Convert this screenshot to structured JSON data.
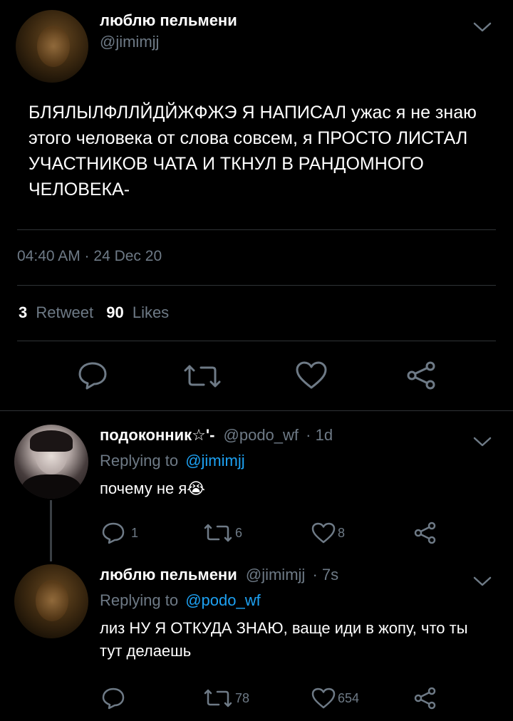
{
  "tweet": {
    "author_name": "люблю пельмени",
    "author_handle": "@jimimjj",
    "text": "БЛЯЛЫЛФЛЛЙДЙЖФЖЭ Я НАПИСАЛ ужас я не знаю этого человека от слова совсем, я ПРОСТО ЛИСТАЛ УЧАСТНИКОВ ЧАТА И ТКНУЛ В РАНДОМНОГО ЧЕЛОВЕКА-",
    "timestamp": "04:40 AM · 24 Dec 20",
    "retweets": "3",
    "retweets_label": "Retweet",
    "likes": "90",
    "likes_label": "Likes"
  },
  "replies": [
    {
      "author_name": "подоконник☆'-",
      "author_handle": "@podo_wf",
      "time": "· 1d",
      "replying_prefix": "Replying to",
      "replying_to": "@jimimjj",
      "text": "почему не я😭",
      "reply_count": "1",
      "retweet_count": "6",
      "like_count": "8"
    },
    {
      "author_name": "люблю пельмени",
      "author_handle": "@jimimjj",
      "time": "· 7s",
      "replying_prefix": "Replying to",
      "replying_to": "@podo_wf",
      "text": "лиз НУ Я ОТКУДА ЗНАЮ, ваще иди в жопу, что ты тут делаешь",
      "reply_count": "",
      "retweet_count": "78",
      "like_count": "654"
    }
  ],
  "icons": [
    "chevron-down-icon",
    "reply-icon",
    "retweet-icon",
    "like-icon",
    "share-icon"
  ],
  "colors": {
    "background": "#000000",
    "muted": "#6e7a86",
    "link": "#1da1f2",
    "divider": "#2f3336"
  }
}
